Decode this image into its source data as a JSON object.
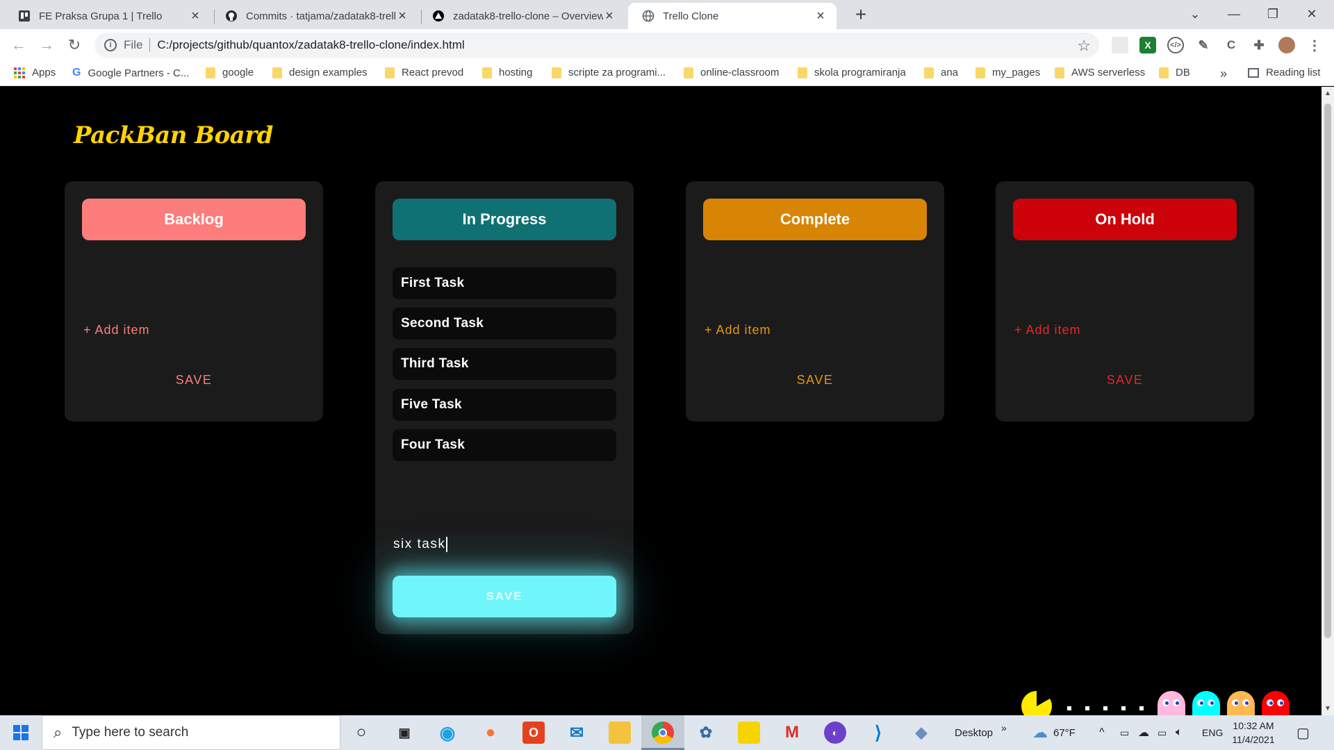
{
  "browser": {
    "tabs": [
      {
        "title": "FE Praksa Grupa 1 | Trello",
        "icon": "trello-icon"
      },
      {
        "title": "Commits · tatjama/zadatak8-trell",
        "icon": "github-icon"
      },
      {
        "title": "zadatak8-trello-clone – Overview",
        "icon": "vercel-icon"
      },
      {
        "title": "Trello Clone",
        "icon": "globe-icon",
        "active": true
      }
    ],
    "address": {
      "scheme": "File",
      "url": "C:/projects/github/quantox/zadatak8-trello-clone/index.html"
    },
    "bookmarks": [
      "Apps",
      "Google Partners - C...",
      "google",
      "design examples",
      "React prevod",
      "hosting",
      "scripte za programi...",
      "online-classroom",
      "skola programiranja",
      "ana",
      "my_pages",
      "AWS serverless",
      "DB"
    ],
    "bookmarks_overflow": "»",
    "reading_list": "Reading list"
  },
  "board": {
    "title": "PackBan Board",
    "columns": [
      {
        "name": "Backlog",
        "color": "#fc7d7b",
        "accent": "#fc7d7b",
        "tasks": [],
        "add_label": "+ Add item",
        "save_label": "SAVE"
      },
      {
        "name": "In Progress",
        "color": "#0f7173",
        "accent": "#6ff6fb",
        "tasks": [
          "First Task",
          "Second Task",
          "Third Task",
          "Five Task",
          "Four Task"
        ],
        "input_value": "six task",
        "save_label": "SAVE"
      },
      {
        "name": "Complete",
        "color": "#d88405",
        "accent": "#e8940f",
        "tasks": [],
        "add_label": "+ Add item",
        "save_label": "SAVE"
      },
      {
        "name": "On Hold",
        "color": "#cc030a",
        "accent": "#e8242a",
        "tasks": [],
        "add_label": "+ Add item",
        "save_label": "SAVE"
      }
    ]
  },
  "taskbar": {
    "search_placeholder": "Type here to search",
    "desktop_label": "Desktop",
    "desktop_chevron": "»",
    "weather": "67°F",
    "language": "ENG",
    "time": "10:32 AM",
    "date": "11/4/2021"
  }
}
